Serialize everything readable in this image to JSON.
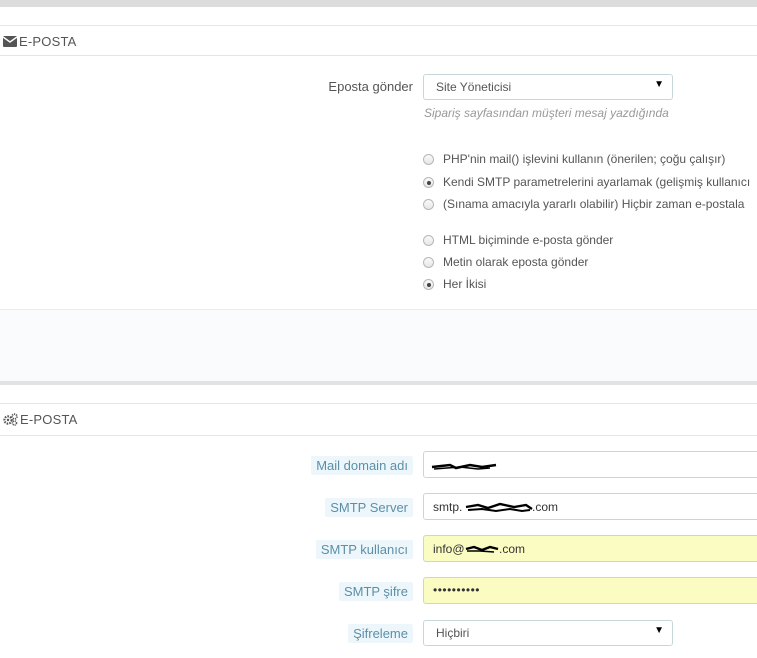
{
  "section1": {
    "title": "E-POSTA",
    "icon": "envelope-icon",
    "send_email_label": "Eposta gönder",
    "send_email_value": "Site Yöneticisi",
    "send_email_help": "Sipariş sayfasından müşteri mesaj yazdığında",
    "mail_method_options": [
      {
        "label": "PHP'nin mail() işlevini kullanın (önerilen; çoğu çalışır)",
        "checked": false
      },
      {
        "label": "Kendi SMTP parametrelerini ayarlamak (gelişmiş kullanıcı",
        "checked": true
      },
      {
        "label": "(Sınama amacıyla yararlı olabilir) Hiçbir zaman e-postala",
        "checked": false
      }
    ],
    "format_options": [
      {
        "label": "HTML biçiminde e-posta gönder",
        "checked": false
      },
      {
        "label": "Metin olarak eposta gönder",
        "checked": false
      },
      {
        "label": "Her İkisi",
        "checked": true
      }
    ]
  },
  "section2": {
    "title": "E-POSTA",
    "icon": "gears-icon",
    "mail_domain_label": "Mail domain adı",
    "mail_domain_value": "",
    "smtp_server_label": "SMTP Server",
    "smtp_server_prefix": "smtp.",
    "smtp_server_suffix": ".com",
    "smtp_user_label": "SMTP kullanıcı",
    "smtp_user_prefix": "info@",
    "smtp_user_suffix": ".com",
    "smtp_password_label": "SMTP şifre",
    "smtp_password_value": "••••••••••",
    "encryption_label": "Şifreleme",
    "encryption_value": "Hiçbiri"
  },
  "colors": {
    "label_tag_bg": "#edf7fb",
    "label_tag_text": "#5b8fa8",
    "autofill_yellow": "#fbfcc2",
    "input_border": "#c7d6db"
  }
}
